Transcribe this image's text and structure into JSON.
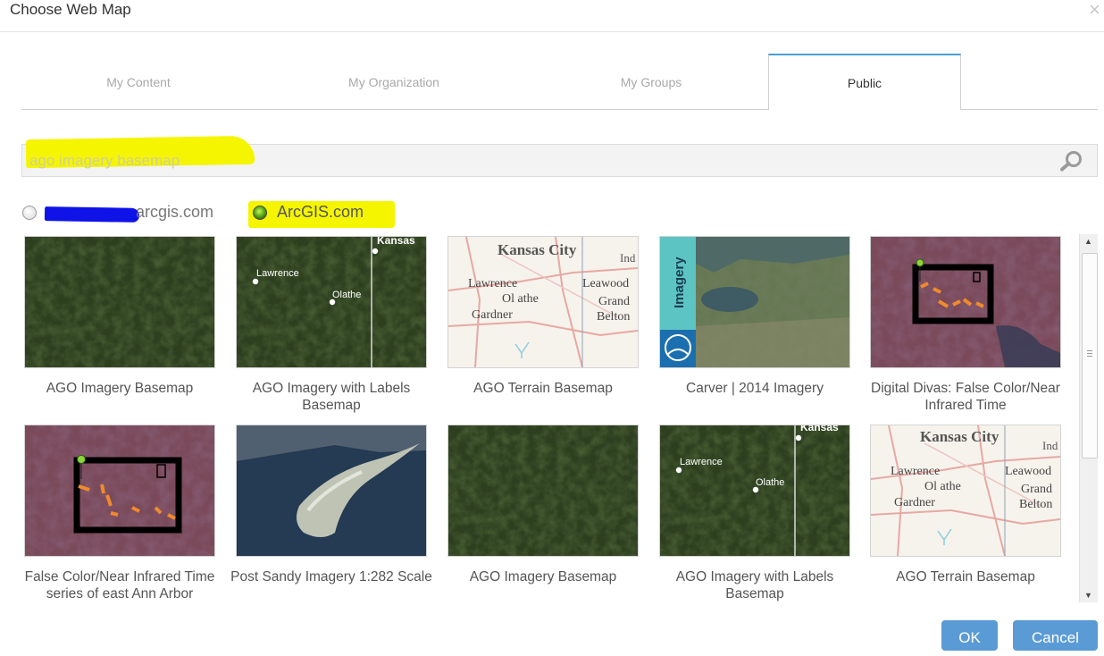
{
  "dialog": {
    "title": "Choose Web Map",
    "close_glyph": "×"
  },
  "tabs": [
    {
      "label": "My Content"
    },
    {
      "label": "My Organization"
    },
    {
      "label": "My Groups"
    },
    {
      "label": "Public"
    }
  ],
  "active_tab": "Public",
  "search": {
    "value": "ago imagery basemap"
  },
  "sources": [
    {
      "label": "arcgis.com",
      "selected": false
    },
    {
      "label": "ArcGIS.com",
      "selected": true
    }
  ],
  "results": [
    {
      "title": "AGO Imagery Basemap"
    },
    {
      "title": "AGO Imagery with Labels Basemap"
    },
    {
      "title": "AGO Terrain Basemap"
    },
    {
      "title": "Carver | 2014 Imagery"
    },
    {
      "title": "Digital Divas: False Color/Near Infrared Time"
    },
    {
      "title": "False Color/Near Infrared Time series of east Ann Arbor"
    },
    {
      "title": "Post Sandy Imagery 1:282 Scale"
    },
    {
      "title": "AGO Imagery Basemap"
    },
    {
      "title": "AGO Imagery with Labels Basemap"
    },
    {
      "title": "AGO Terrain Basemap"
    }
  ],
  "map_labels": {
    "kansas": "Kansas",
    "kansas_city": "Kansas City",
    "lawrence": "Lawrence",
    "olathe": "Olathe",
    "olathe_terrain": "Ol athe",
    "gardner": "Gardner",
    "leawood": "Leawood",
    "grand": "Grand",
    "belton": "Belton",
    "ind": "Ind",
    "imagery": "Imagery"
  },
  "buttons": {
    "ok": "OK",
    "cancel": "Cancel"
  },
  "colors": {
    "accent": "#4a9fd8",
    "button": "#5b9bd5",
    "highlight": "#f5f500",
    "redaction": "#1013e8"
  }
}
